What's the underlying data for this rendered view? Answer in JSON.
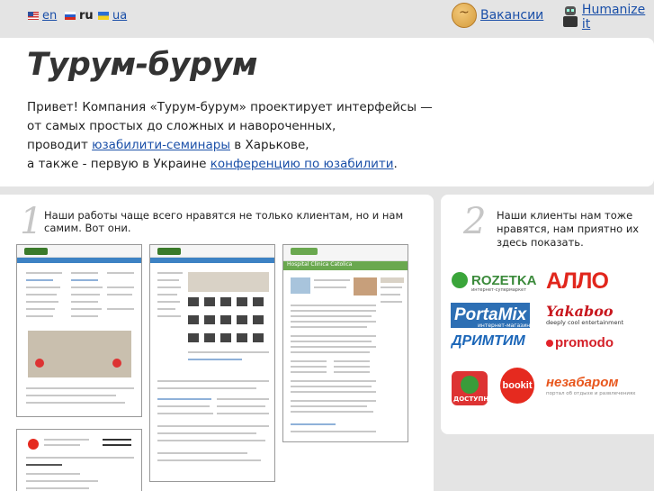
{
  "languages": [
    {
      "code": "en",
      "label": "en",
      "current": false
    },
    {
      "code": "ru",
      "label": "ru",
      "current": true
    },
    {
      "code": "ua",
      "label": "ua",
      "current": false
    }
  ],
  "header": {
    "vacancies_label": "Вакансии",
    "humanize_label": "Humanize it"
  },
  "intro": {
    "title": "Турум-бурум",
    "line1": "Привет! Компания «Турум-бурум» проектирует интерфейсы —",
    "line2": "от самых простых до сложных и навороченных,",
    "line3_pre": "проводит ",
    "line3_link": "юзабилити-семинары",
    "line3_post": " в Харькове,",
    "line4_pre": "а также - первую в Украине ",
    "line4_link": "конференцию по юзабилити",
    "line4_post": "."
  },
  "works": {
    "number": "1",
    "caption": "Наши работы чаще всего нравятся не только клиентам, но и нам самим. Вот они.",
    "thumb3_title": "Hospital Clinica Catolica"
  },
  "clients": {
    "number": "2",
    "caption": "Наши клиенты нам тоже нравятся, нам приятно их здесь показать.",
    "logos": {
      "rozetka": "ROZETKA",
      "rozetka_sub": "интернет-супермаркет",
      "allo": "АЛЛО",
      "portamix": "PortaMix",
      "portamix_sub": "интернет-магазин",
      "yakaboo": "Yakaboo",
      "yakaboo_sub": "deeply cool entertainment",
      "dreamtim": "ДРИМТИМ",
      "promodo": "promodo",
      "dostupno": "ДОСТУПНО",
      "bookit": "bookit",
      "nezabarom": "незабаром",
      "nezabarom_sub": "портал об отдыхе и развлечениях"
    }
  }
}
